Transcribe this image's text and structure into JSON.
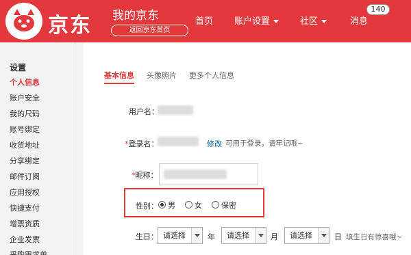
{
  "header": {
    "logo_text": "京东",
    "title": "我的京东",
    "back_home": "返回京东首页",
    "nav": {
      "home": "首页",
      "account_settings": "账户设置",
      "community": "社区",
      "messages": "消息"
    },
    "message_count": "140"
  },
  "sidebar": {
    "title": "设置",
    "items": [
      {
        "label": "个人信息",
        "active": true
      },
      {
        "label": "账户安全"
      },
      {
        "label": "我的尺码"
      },
      {
        "label": "账号绑定"
      },
      {
        "label": "收货地址"
      },
      {
        "label": "分享绑定"
      },
      {
        "label": "邮件订阅"
      },
      {
        "label": "应用授权"
      },
      {
        "label": "快捷支付"
      },
      {
        "label": "增票资质"
      },
      {
        "label": "企业发票"
      },
      {
        "label": "采购需求单"
      }
    ]
  },
  "main": {
    "tabs": [
      {
        "label": "基本信息",
        "active": true
      },
      {
        "label": "头像照片"
      },
      {
        "label": "更多个人信息"
      }
    ],
    "username_label": "用户名：",
    "login_name_label": "登录名：",
    "required_mark": "*",
    "modify_link": "修改",
    "login_hint": "可用于登录，请牢记哦~",
    "nickname_label": "昵称：",
    "gender_label": "性别：",
    "gender_options": [
      "男",
      "女",
      "保密"
    ],
    "gender_selected": "男",
    "birthday_label": "生日：",
    "select_placeholder": "请选择",
    "year_unit": "年",
    "month_unit": "月",
    "day_unit": "日",
    "birthday_hint": "填生日有惊喜哦~"
  },
  "colors": {
    "brand_red": "#e4393c",
    "link_blue": "#005ea7"
  }
}
